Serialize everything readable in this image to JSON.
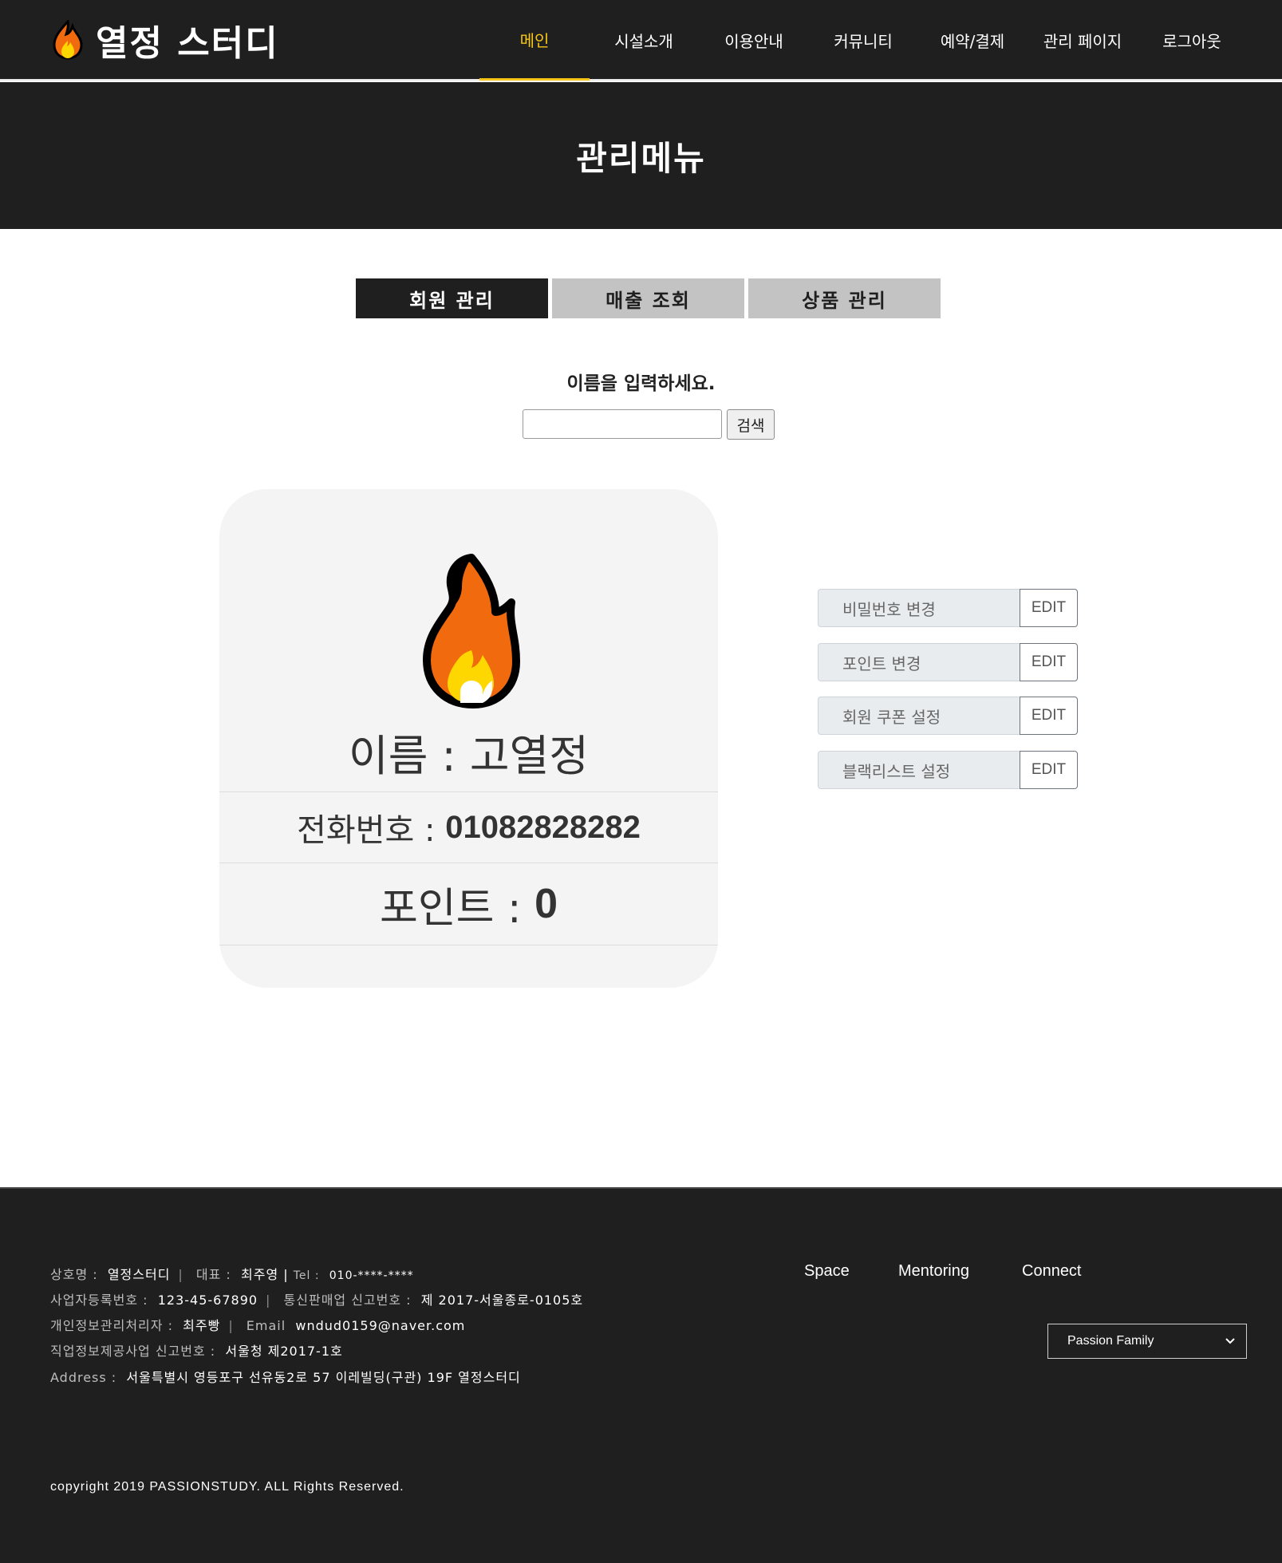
{
  "header": {
    "logo_text": "열정 스터디",
    "logo_icon": "flame-icon",
    "nav": [
      {
        "label": "메인",
        "active": true
      },
      {
        "label": "시설소개"
      },
      {
        "label": "이용안내"
      },
      {
        "label": "커뮤니티"
      },
      {
        "label": "예약/결제"
      },
      {
        "label": "관리 페이지"
      },
      {
        "label": "로그아웃"
      }
    ]
  },
  "banner": {
    "title": "관리메뉴"
  },
  "tabs": [
    {
      "label": "회원 관리",
      "active": true
    },
    {
      "label": "매출 조회"
    },
    {
      "label": "상품 관리"
    }
  ],
  "search": {
    "label": "이름을 입력하세요.",
    "value": "",
    "button_label": "검색"
  },
  "member": {
    "icon": "flame-icon",
    "name_label": "이름 : ",
    "name": "고열정",
    "phone_label": "전화번호 : ",
    "phone": "01082828282",
    "point_label": "포인트 : ",
    "point": "0"
  },
  "actions": [
    {
      "label": "비밀번호 변경",
      "button": "EDIT"
    },
    {
      "label": "포인트 변경",
      "button": "EDIT"
    },
    {
      "label": "회원 쿠폰 설정",
      "button": "EDIT"
    },
    {
      "label": "블랙리스트 설정",
      "button": "EDIT"
    }
  ],
  "footer": {
    "company_label": "상호명 :",
    "company": "열정스터디",
    "ceo_label": "대표 :",
    "ceo": "최주영",
    "tel_label": "Tel :",
    "tel": "010-****-****",
    "biz_no_label": "사업자등록번호 :",
    "biz_no": "123-45-67890",
    "mail_order_label": "통신판매업 신고번호 :",
    "mail_order": "제 2017-서울종로-0105호",
    "privacy_label": "개인정보관리처리자 :",
    "privacy": "최주빵",
    "email_label": "Email",
    "email": "wndud0159@naver.com",
    "job_info_label": "직업정보제공사업 신고번호 :",
    "job_info": "서울청 제2017-1호",
    "address_label": "Address :",
    "address": "서울특별시 영등포구 선유동2로 57 이레빌딩(구관) 19F 열정스터디",
    "links": [
      "Space",
      "Mentoring",
      "Connect"
    ],
    "family_select": "Passion Family",
    "copyright": "copyright 2019 PASSIONSTUDY. ALL Rights Reserved."
  },
  "colors": {
    "dark": "#1f1f1f",
    "accent": "#f5c518",
    "tab_inactive": "#c3c3c3",
    "flame_orange": "#f26a0e",
    "flame_yellow": "#ffd700"
  }
}
